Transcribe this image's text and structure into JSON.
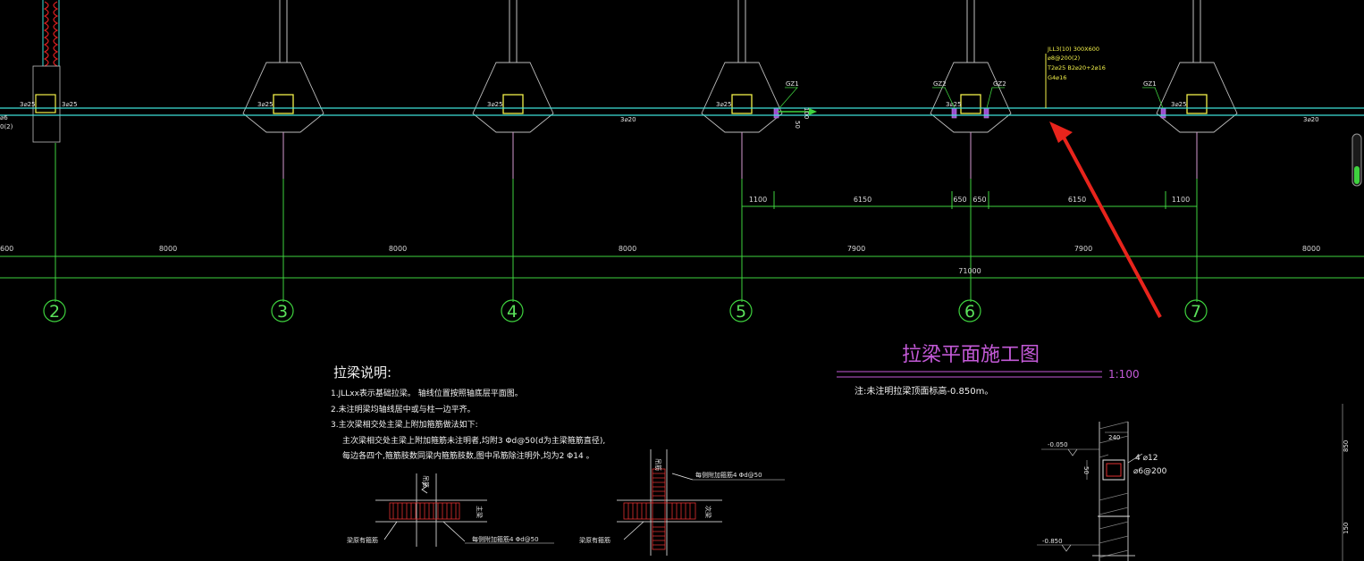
{
  "drawing": {
    "title": "拉梁平面施工图",
    "scale": "1:100",
    "elevation_note": "注:未注明拉梁顶面标高-0.850m。"
  },
  "axes": [
    "2",
    "3",
    "4",
    "5",
    "6",
    "7"
  ],
  "axis_spans": {
    "left_partial": "600",
    "s2_3": "8000",
    "s3_4": "8000",
    "s4_5": "8000",
    "s5_6": "7900",
    "s6_7": "7900",
    "right_partial": "8000",
    "total": "71000"
  },
  "detail_dims": [
    "1100",
    "6150",
    "650",
    "650",
    "6150",
    "1100"
  ],
  "rebar": {
    "bar_3d25": "3⌀25",
    "bar_3d20": "3⌀20",
    "left_edge_1": "⌀6",
    "left_edge_2": "0(2)",
    "gz1": "GZ1",
    "gz2": "GZ2",
    "dim_100": "100",
    "dim_50": "50"
  },
  "beam_callout": {
    "line1": "JLL3(10) 300X600",
    "line2": "⌀8@200(2)",
    "line3": "T2⌀25  B2⌀20+2⌀16",
    "line4": "G4⌀16"
  },
  "notes": {
    "heading": "拉梁说明:",
    "line1": "1.JLLxx表示基础拉梁。    轴线位置按照轴底层平面图。",
    "line2": "2.未注明梁均轴线居中或与柱一边平齐。",
    "line3": "3.主次梁相交处主梁上附加箍筋做法如下:",
    "line4": "主次梁相交处主梁上附加箍筋未注明者,均附3 Φd@50(d为主梁箍筋直径),",
    "line5": "每边各四个,箍筋肢数同梁内箍筋肢数,图中吊筋除注明外,均为2 Φ14 。"
  },
  "detail_labels": {
    "main_beam": "主梁",
    "sub_beam": "次梁",
    "hanger_a": "吊筋",
    "hanger_b": "吊筋",
    "beam_stirrup_a": "梁原有箍筋",
    "beam_stirrup_b": "梁原有箍筋",
    "added_stirrup_a": "每侧附加箍筋4 Φd@50",
    "added_stirrup_b": "每侧附加箍筋4 Φd@50"
  },
  "section": {
    "elev_top": "-0.050",
    "elev_bottom": "-0.850",
    "width": "240",
    "top_bar": "4 ⌀12",
    "stirrup": "⌀6@200",
    "dim_50": "50",
    "dim_850": "850",
    "dim_150": "150"
  },
  "colors": {
    "background": "#000000",
    "axis_green": "#3ed23e",
    "beam_cyan": "#3ee0d8",
    "column_yellow": "#f2f04a",
    "title_magenta": "#c45ad8",
    "arrow_red": "#e8241c"
  }
}
